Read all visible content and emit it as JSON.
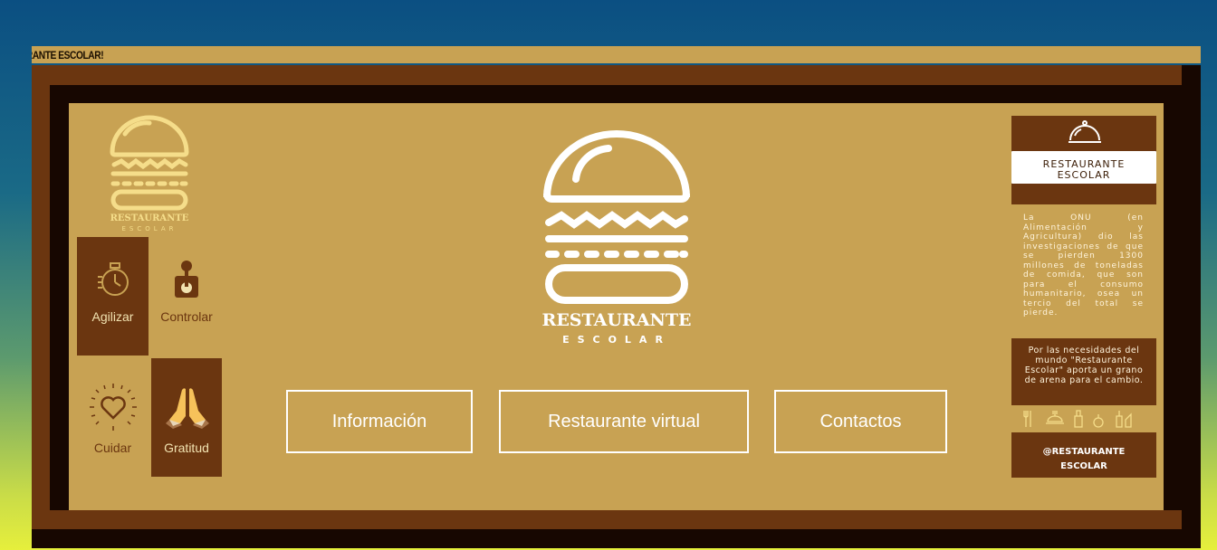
{
  "marquee": {
    "text": "AURANTE ESCOLAR!"
  },
  "logo_small": {
    "title": "RESTAURANTE",
    "subtitle": "ESCOLAR"
  },
  "logo_center": {
    "title": "RESTAURANTE",
    "subtitle": "ESCOLAR"
  },
  "values": [
    {
      "label": "Agilizar",
      "icon": "stopwatch-icon"
    },
    {
      "label": "Controlar",
      "icon": "joystick-icon"
    },
    {
      "label": "Cuidar",
      "icon": "heart-icon"
    },
    {
      "label": "Gratitud",
      "icon": "praying-hands-icon"
    }
  ],
  "nav": {
    "info": "Información",
    "virtual": "Restaurante virtual",
    "contacts": "Contactos"
  },
  "sidebar": {
    "banner_title": "RESTAURANTE",
    "banner_subtitle": "ESCOLAR",
    "paragraph": "La ONU (en Alimentación y Agricultura) dio las investigaciones de que se pierden 1300 millones de toneladas de comida, que son para el consumo humanitario, osea un tercio del total se pierde.",
    "mission": "Por las necesidades del mundo \"Restaurante Escolar\" aporta un grano de arena para el cambio.",
    "handle_line1": "@RESTAURANTE",
    "handle_line2": "ESCOLAR"
  },
  "colors": {
    "panel": "#c8a253",
    "brown": "#6b3610",
    "dark": "#170701",
    "logo_light": "#f5dd8a"
  }
}
